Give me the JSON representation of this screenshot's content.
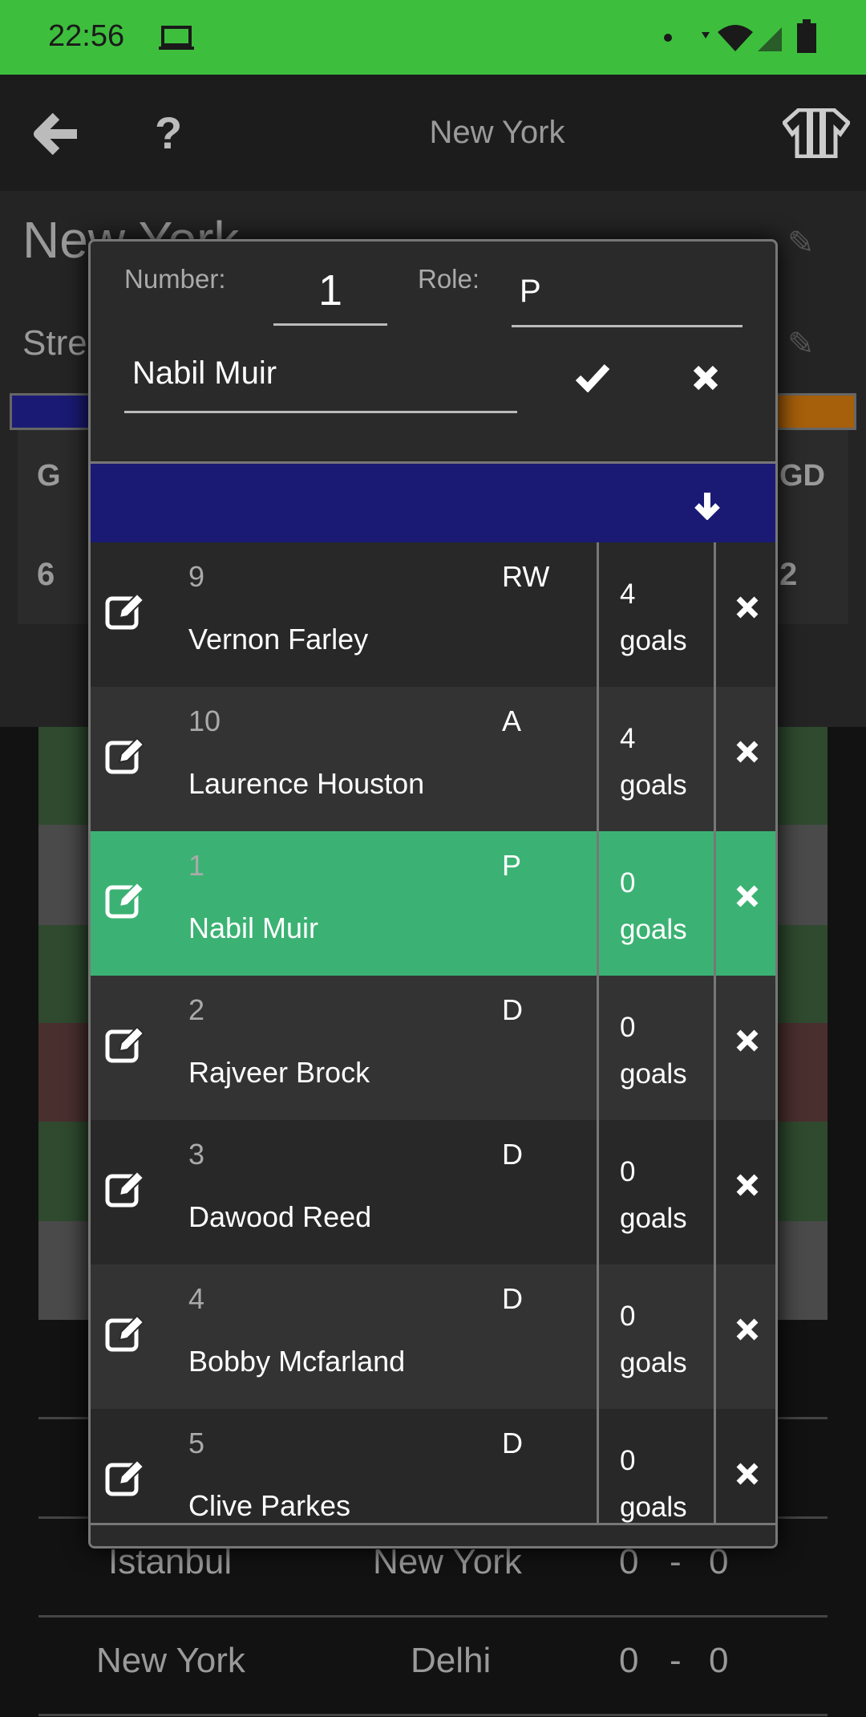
{
  "status_bar": {
    "time": "22:56",
    "icons": [
      "laptop-icon",
      "dot-icon",
      "wifi-icon",
      "signal-icon",
      "battery-icon"
    ],
    "color": "#3dbf3d"
  },
  "app_bar": {
    "title": "New York",
    "back_icon": "arrow-left-icon",
    "help_icon": "question-icon",
    "jersey_icon": "jersey-icon"
  },
  "background": {
    "team_name": "New York",
    "stadium_partial": "Stre",
    "stats_headers": [
      "G",
      "GD"
    ],
    "stats_values": [
      "6",
      "2"
    ],
    "matches": [
      {
        "home": "Istanbul",
        "away": "New York",
        "score_home": "0",
        "sep": "-",
        "score_away": "0"
      },
      {
        "home": "New York",
        "away": "Delhi",
        "score_home": "0",
        "sep": "-",
        "score_away": "0"
      }
    ],
    "colors": {
      "primary": "#1a1a75",
      "secondary": "#a65f0a"
    }
  },
  "dialog": {
    "number_label": "Number:",
    "number_value": "1",
    "role_label": "Role:",
    "role_value": "P",
    "name_value": "Nabil Muir",
    "sort_icon": "arrow-down-icon",
    "players": [
      {
        "number": "9",
        "name": "Vernon Farley",
        "role": "RW",
        "goals": "4",
        "goals_unit": "goals",
        "selected": false
      },
      {
        "number": "10",
        "name": "Laurence Houston",
        "role": "A",
        "goals": "4",
        "goals_unit": "goals",
        "selected": false
      },
      {
        "number": "1",
        "name": "Nabil Muir",
        "role": "P",
        "goals": "0",
        "goals_unit": "goals",
        "selected": true
      },
      {
        "number": "2",
        "name": "Rajveer Brock",
        "role": "D",
        "goals": "0",
        "goals_unit": "goals",
        "selected": false
      },
      {
        "number": "3",
        "name": "Dawood Reed",
        "role": "D",
        "goals": "0",
        "goals_unit": "goals",
        "selected": false
      },
      {
        "number": "4",
        "name": "Bobby Mcfarland",
        "role": "D",
        "goals": "0",
        "goals_unit": "goals",
        "selected": false
      },
      {
        "number": "5",
        "name": "Clive Parkes",
        "role": "D",
        "goals": "0",
        "goals_unit": "goals",
        "selected": false
      }
    ],
    "selected_color": "#3bb273",
    "header_color": "#1a1a75"
  }
}
